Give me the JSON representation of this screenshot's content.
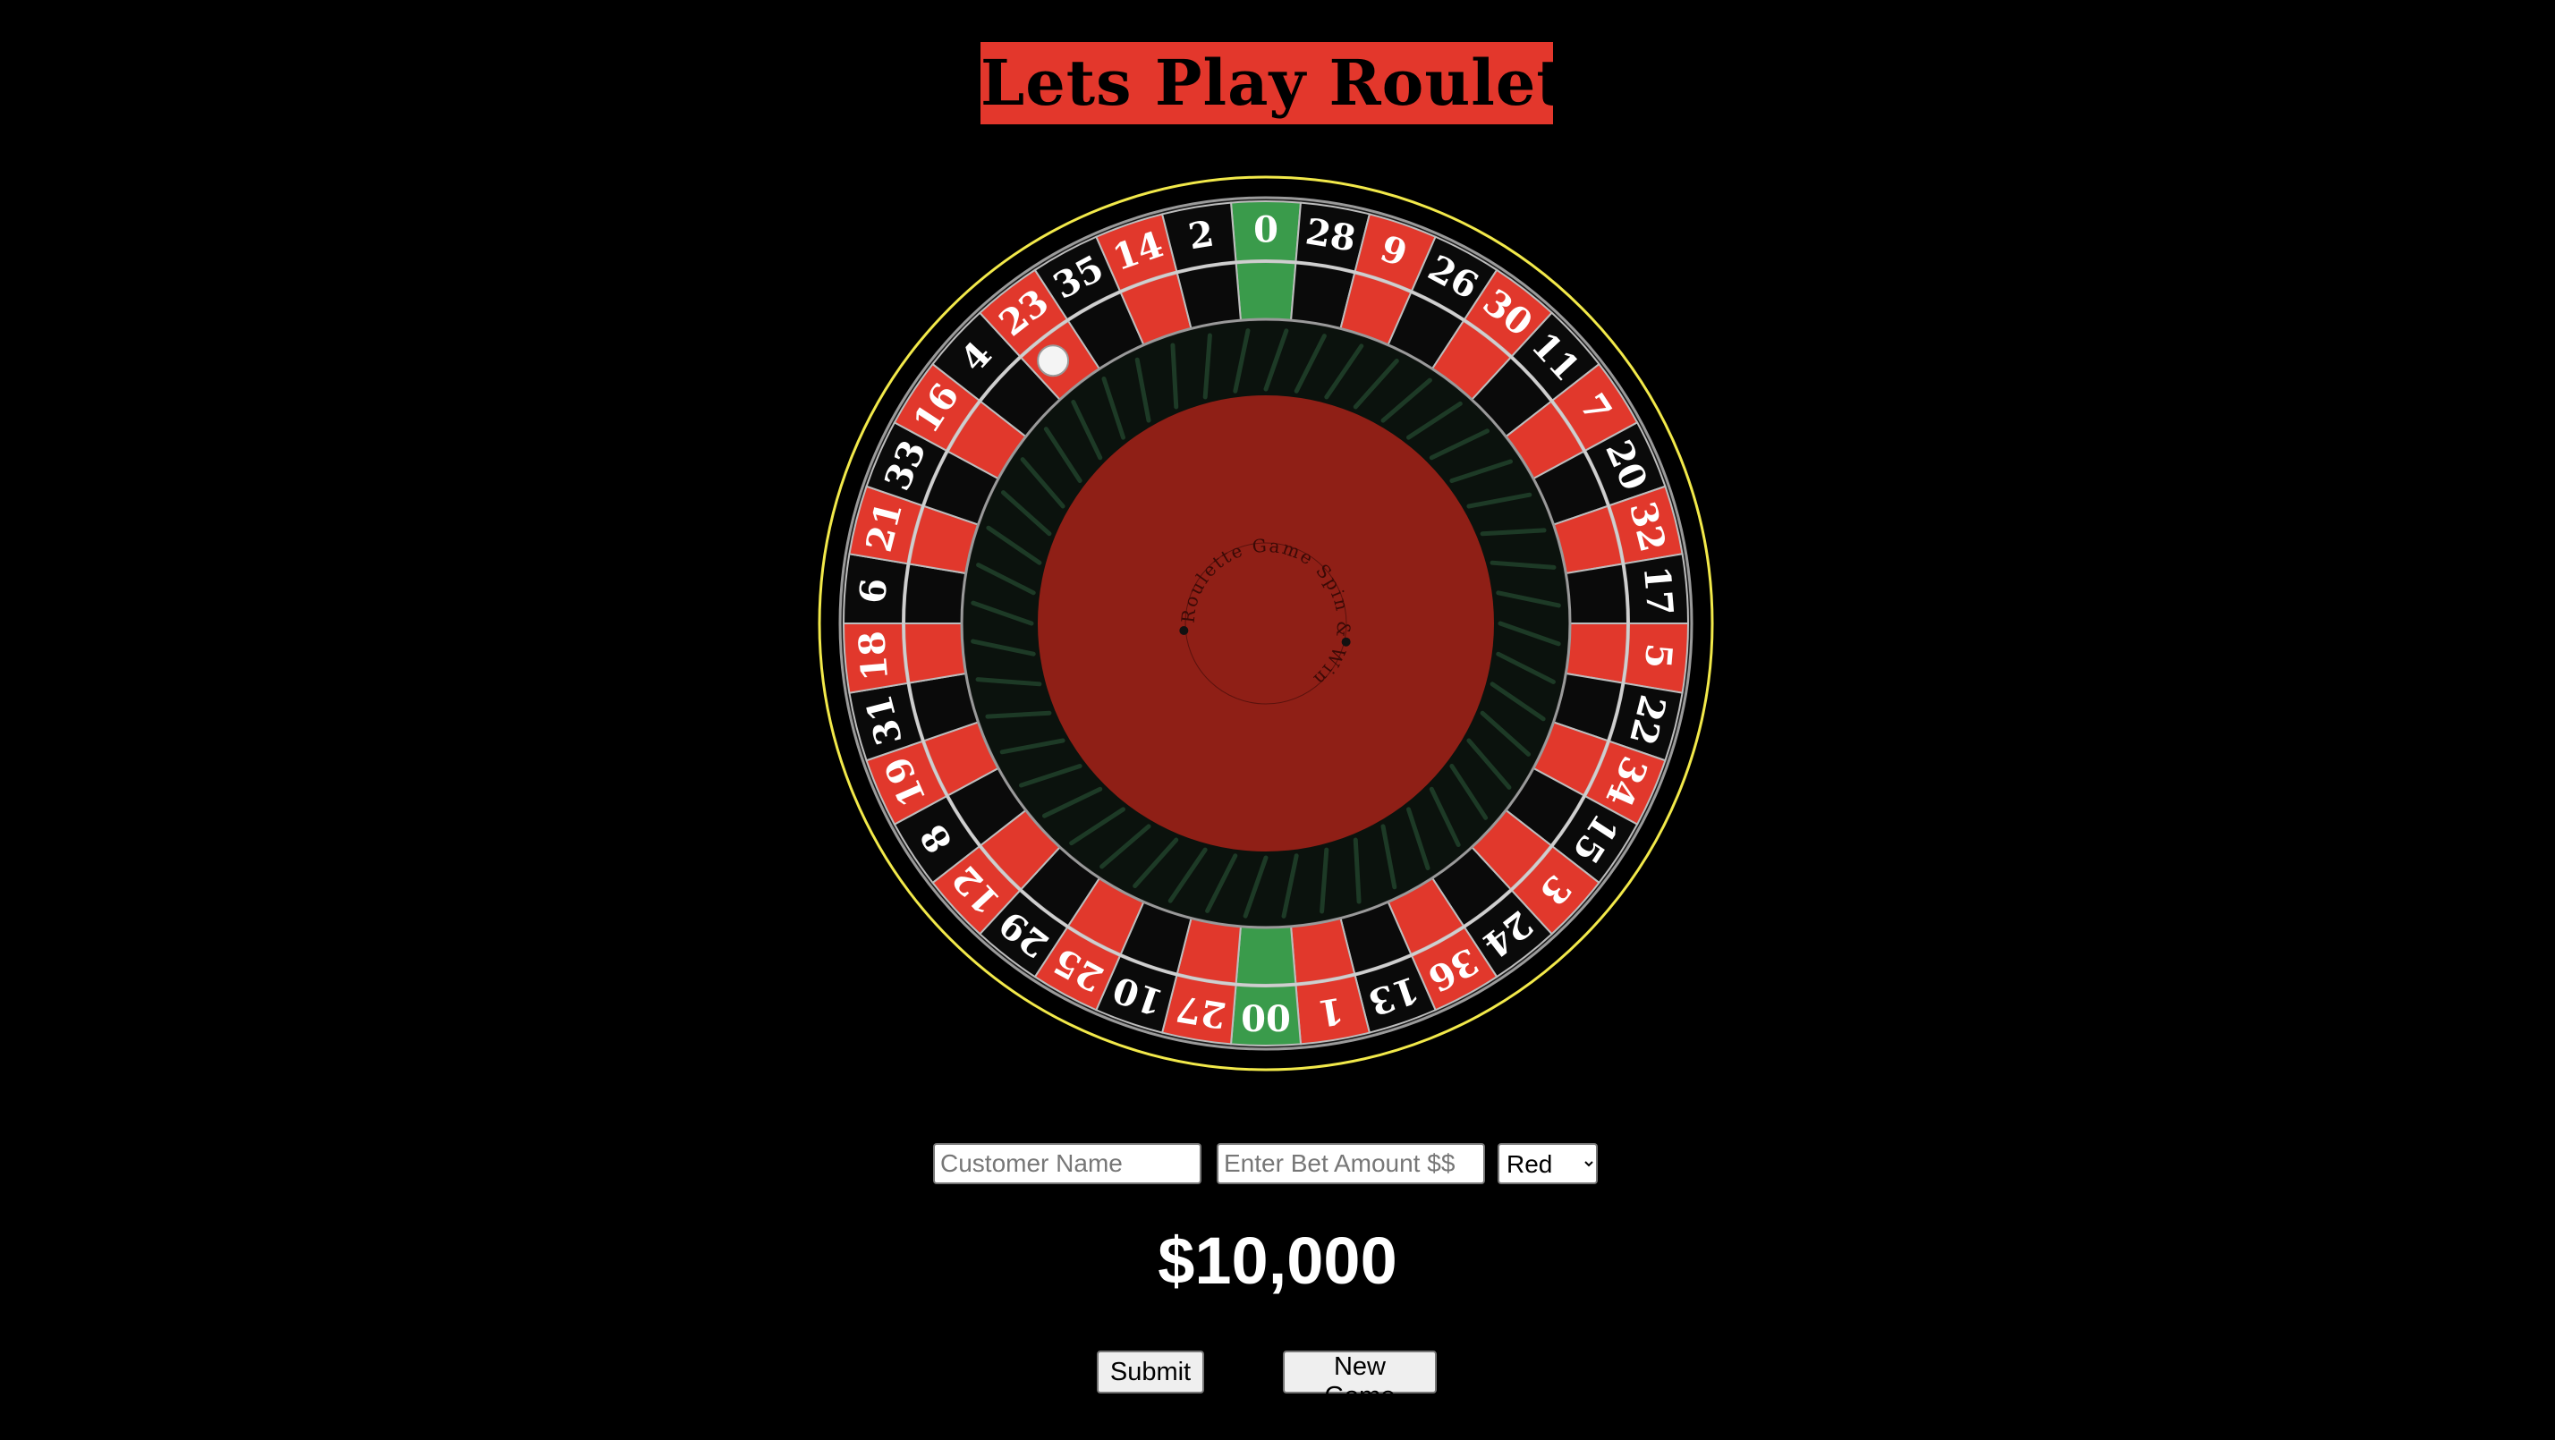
{
  "header": {
    "title": "Lets Play Roulette"
  },
  "wheel": {
    "numbers": [
      "0",
      "28",
      "9",
      "26",
      "30",
      "11",
      "7",
      "20",
      "32",
      "17",
      "5",
      "22",
      "34",
      "15",
      "3",
      "24",
      "36",
      "13",
      "1",
      "00",
      "27",
      "10",
      "25",
      "29",
      "12",
      "8",
      "19",
      "31",
      "18",
      "6",
      "21",
      "33",
      "16",
      "4",
      "23",
      "35",
      "14",
      "2"
    ],
    "pocket_colors": [
      "green",
      "black",
      "red",
      "black",
      "red",
      "black",
      "red",
      "black",
      "red",
      "black",
      "red",
      "black",
      "red",
      "black",
      "red",
      "black",
      "red",
      "black",
      "red",
      "green",
      "red",
      "black",
      "red",
      "black",
      "red",
      "black",
      "red",
      "black",
      "red",
      "black",
      "red",
      "black",
      "red",
      "black",
      "red",
      "black",
      "red",
      "black"
    ],
    "center_text": "Roulette Game Spin & Win",
    "colors": {
      "red": "#e1382c",
      "black": "#0a0a0a",
      "green": "#3a9b4b",
      "center": "#8f1f16",
      "rim": "#f2e94a",
      "ball": "#f4f4f4"
    }
  },
  "form": {
    "name_placeholder": "Customer Name",
    "bet_placeholder": "Enter Bet Amount $$",
    "color_selected": "Red"
  },
  "bankroll": "$10,000",
  "buttons": {
    "submit": "Submit",
    "new_game": "New Game"
  }
}
